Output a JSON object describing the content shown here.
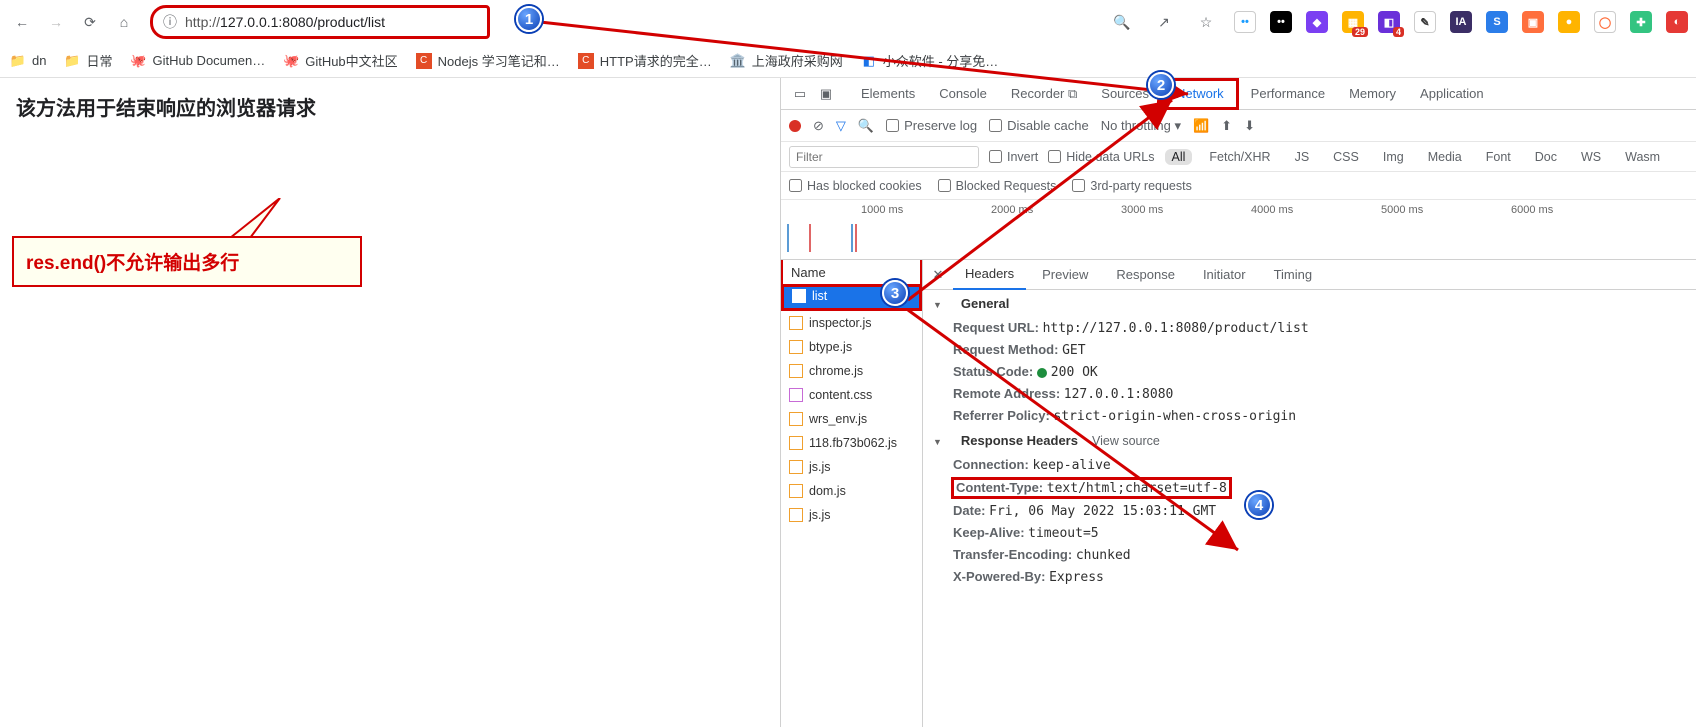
{
  "browser": {
    "url_scheme": "http://",
    "url_rest": "127.0.0.1:8080/product/list",
    "bookmarks": [
      "dn",
      "日常",
      "GitHub Documen…",
      "GitHub中文社区",
      "Nodejs 学习笔记和…",
      "HTTP请求的完全…",
      "上海政府采购网",
      "小众软件 - 分享免…"
    ]
  },
  "page": {
    "heading": "该方法用于结束响应的浏览器请求",
    "callout": "res.end()不允许输出多行"
  },
  "devtools": {
    "tabs": [
      "Elements",
      "Console",
      "Recorder ⧉",
      "Sources",
      "Network",
      "Performance",
      "Memory",
      "Application"
    ],
    "preserve_log": "Preserve log",
    "disable_cache": "Disable cache",
    "throttling": "No throttling",
    "filter_placeholder": "Filter",
    "invert": "Invert",
    "hide_data": "Hide data URLs",
    "type_pills": [
      "All",
      "Fetch/XHR",
      "JS",
      "CSS",
      "Img",
      "Media",
      "Font",
      "Doc",
      "WS",
      "Wasm"
    ],
    "blocked_cookies": "Has blocked cookies",
    "blocked_requests": "Blocked Requests",
    "third_party": "3rd-party requests",
    "ticks": [
      "1000 ms",
      "2000 ms",
      "3000 ms",
      "4000 ms",
      "5000 ms",
      "6000 ms"
    ],
    "name_header": "Name",
    "requests": [
      "list",
      "inspector.js",
      "btype.js",
      "chrome.js",
      "content.css",
      "wrs_env.js",
      "118.fb73b062.js",
      "js.js",
      "dom.js",
      "js.js"
    ],
    "detail_tabs": [
      "Headers",
      "Preview",
      "Response",
      "Initiator",
      "Timing"
    ],
    "general_title": "General",
    "general": {
      "request_url_label": "Request URL:",
      "request_url": "http://127.0.0.1:8080/product/list",
      "request_method_label": "Request Method:",
      "request_method": "GET",
      "status_code_label": "Status Code:",
      "status_code": "200 OK",
      "remote_addr_label": "Remote Address:",
      "remote_addr": "127.0.0.1:8080",
      "referrer_label": "Referrer Policy:",
      "referrer": "strict-origin-when-cross-origin"
    },
    "response_headers_title": "Response Headers",
    "view_source": "View source",
    "response": {
      "connection_label": "Connection:",
      "connection": "keep-alive",
      "ct_label": "Content-Type:",
      "ct": "text/html;charset=utf-8",
      "date_label": "Date:",
      "date": "Fri, 06 May 2022 15:03:11 GMT",
      "ka_label": "Keep-Alive:",
      "ka": "timeout=5",
      "te_label": "Transfer-Encoding:",
      "te": "chunked",
      "xp_label": "X-Powered-By:",
      "xp": "Express"
    }
  },
  "markers": {
    "1": "1",
    "2": "2",
    "3": "3",
    "4": "4"
  }
}
